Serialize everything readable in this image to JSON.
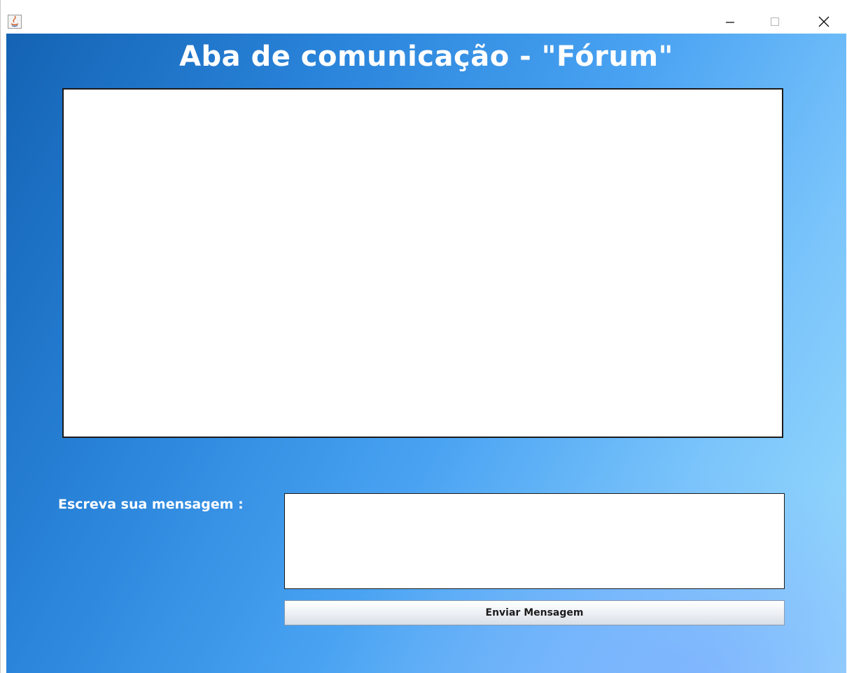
{
  "window": {
    "app_icon": "java-coffee-icon",
    "controls": {
      "minimize_icon": "minimize-icon",
      "maximize_icon": "maximize-icon",
      "close_icon": "close-icon"
    }
  },
  "main": {
    "title": "Aba de comunicação - \"Fórum\"",
    "forum_text": "",
    "message_label": "Escreva sua mensagem :",
    "message_value": "",
    "send_button_label": "Enviar Mensagem"
  },
  "colors": {
    "background_gradient_start": "#1463b4",
    "background_gradient_end": "#9adcfc",
    "text": "#ffffff"
  }
}
